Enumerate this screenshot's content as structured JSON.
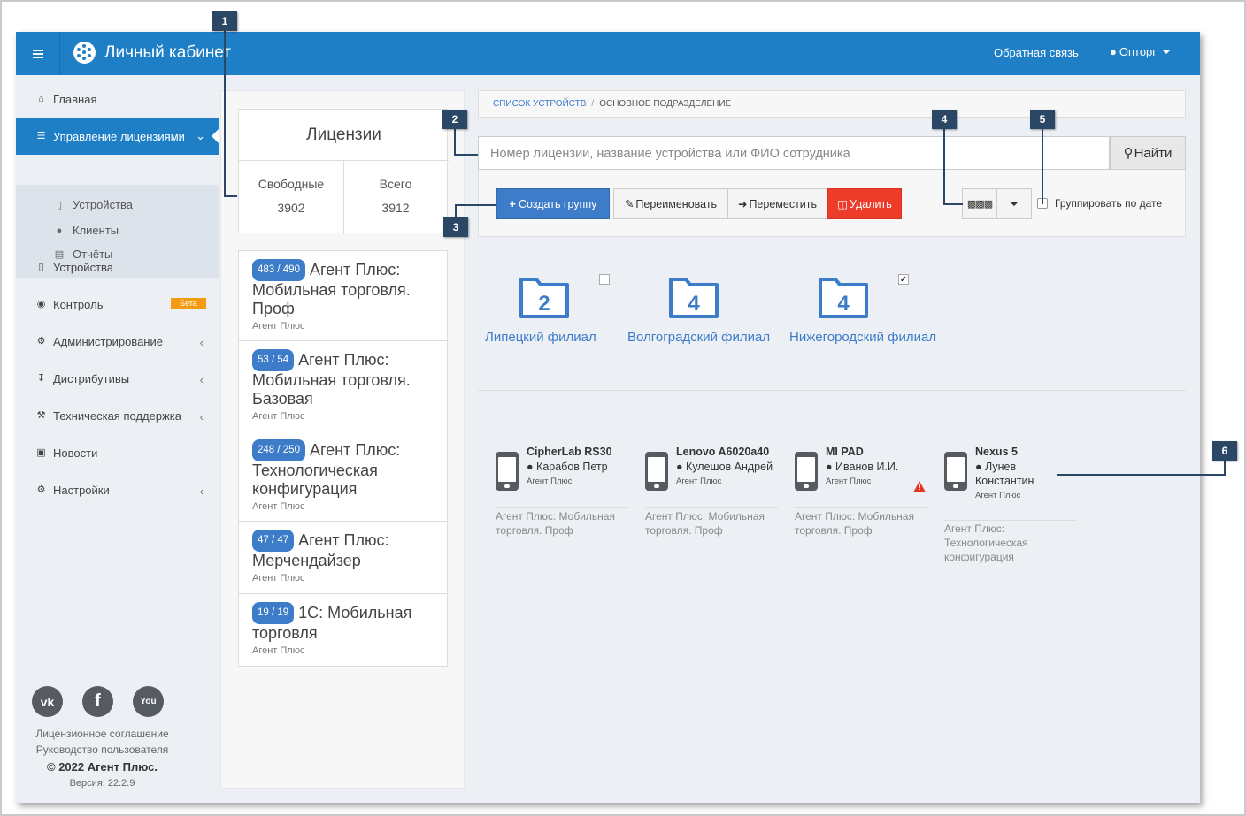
{
  "topbar": {
    "title": "Личный кабинет",
    "feedback": "Обратная связь",
    "user": "Опторг"
  },
  "sidebar": {
    "items": [
      {
        "label": "Главная",
        "icon": "home-icon"
      },
      {
        "label": "Управление лицензиями",
        "icon": "sitemap-icon",
        "active": true
      },
      {
        "label": "Устройства",
        "icon": "mobile-icon"
      },
      {
        "label": "Контроль",
        "icon": "globe-icon",
        "badge": "Бета"
      },
      {
        "label": "Администрирование",
        "icon": "cogs-icon"
      },
      {
        "label": "Дистрибутивы",
        "icon": "download-icon"
      },
      {
        "label": "Техническая поддержка",
        "icon": "wrench-icon"
      },
      {
        "label": "Новости",
        "icon": "newspaper-icon"
      },
      {
        "label": "Настройки",
        "icon": "gear-icon"
      }
    ],
    "subitems": [
      {
        "label": "Устройства",
        "icon": "mobile-icon"
      },
      {
        "label": "Клиенты",
        "icon": "users-icon"
      },
      {
        "label": "Отчёты",
        "icon": "archive-icon"
      }
    ],
    "footer": {
      "agreement": "Лицензионное соглашение",
      "guide": "Руководство пользователя",
      "copyright": "© 2022 Агент Плюс.",
      "version": "Версия: 22.2.9"
    }
  },
  "licenses": {
    "title": "Лицензии",
    "free_label": "Свободные",
    "free_value": "3902",
    "total_label": "Всего",
    "total_value": "3912",
    "products": [
      {
        "count": "483 / 490",
        "name": "Агент Плюс: Мобильная торговля. Проф",
        "vendor": "Агент Плюс"
      },
      {
        "count": "53 / 54",
        "name": "Агент Плюс: Мобильная торговля. Базовая",
        "vendor": "Агент Плюс"
      },
      {
        "count": "248 / 250",
        "name": "Агент Плюс: Технологическая конфигурация",
        "vendor": "Агент Плюс"
      },
      {
        "count": "47 / 47",
        "name": "Агент Плюс: Мерчендайзер",
        "vendor": "Агент Плюс"
      },
      {
        "count": "19 / 19",
        "name": "1С: Мобильная торговля",
        "vendor": "Агент Плюс"
      }
    ]
  },
  "breadcrumb": {
    "link": "Список устройств",
    "current": "Основное подразделение"
  },
  "search": {
    "placeholder": "Номер лицензии, название устройства или ФИО сотрудника",
    "button": "Найти"
  },
  "toolbar": {
    "create": "Создать группу",
    "rename": "Переименовать",
    "move": "Переместить",
    "delete": "Удалить",
    "group_by_date": "Группировать по дате"
  },
  "groups": [
    {
      "count": "2",
      "name": "Липецкий филиал",
      "checked": false
    },
    {
      "count": "4",
      "name": "Волгоградский филиал",
      "checked": null
    },
    {
      "count": "4",
      "name": "Нижегородский филиал",
      "checked": true
    }
  ],
  "devices": [
    {
      "name": "CipherLab RS30",
      "user": "Карабов Петр",
      "vendor": "Агент Плюс",
      "license": "Агент Плюс: Мобильная торговля. Проф"
    },
    {
      "name": "Lenovo A6020a40",
      "user": "Кулешов Андрей",
      "vendor": "Агент Плюс",
      "license": "Агент Плюс: Мобильная торговля. Проф"
    },
    {
      "name": "MI PAD",
      "user": "Иванов И.И.",
      "vendor": "Агент Плюс",
      "license": "Агент Плюс: Мобильная торговля. Проф",
      "warning": true
    },
    {
      "name": "Nexus 5",
      "user": "Лунев Константин",
      "vendor": "Агент Плюс",
      "license": "Агент Плюс: Технологическая конфигурация"
    }
  ],
  "callouts": [
    "1",
    "2",
    "3",
    "4",
    "5",
    "6"
  ],
  "colors": {
    "brand": "#1e7fc7",
    "primary": "#3d7cc9",
    "danger": "#ee3c2a",
    "beta": "#f39c12",
    "callout": "#2b4766"
  }
}
